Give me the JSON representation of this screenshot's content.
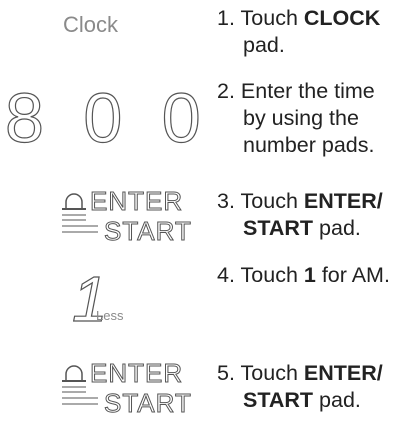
{
  "steps": [
    {
      "pad_label": "Clock",
      "num": "1.",
      "pre": "Touch ",
      "bold": "CLOCK",
      "post": "",
      "line2": "pad."
    },
    {
      "pad_label": "8 0 0",
      "num": "2.",
      "pre": "Enter the time",
      "bold": "",
      "post": "",
      "line2": "by using the",
      "line3": "number pads."
    },
    {
      "pad_label_top": "ENTER",
      "pad_label_bottom": "START",
      "num": "3.",
      "pre": "Touch ",
      "bold": "ENTER/",
      "post": "",
      "line2_bold": "START",
      "line2_post": " pad."
    },
    {
      "pad_label_big": "1",
      "pad_label_small": "Less",
      "num": "4.",
      "pre": "Touch ",
      "bold": "1",
      "post": " for AM."
    },
    {
      "pad_label_top": "ENTER",
      "pad_label_bottom": "START",
      "num": "5.",
      "pre": "Touch ",
      "bold": "ENTER/",
      "post": "",
      "line2_bold": "START",
      "line2_post": " pad."
    }
  ]
}
